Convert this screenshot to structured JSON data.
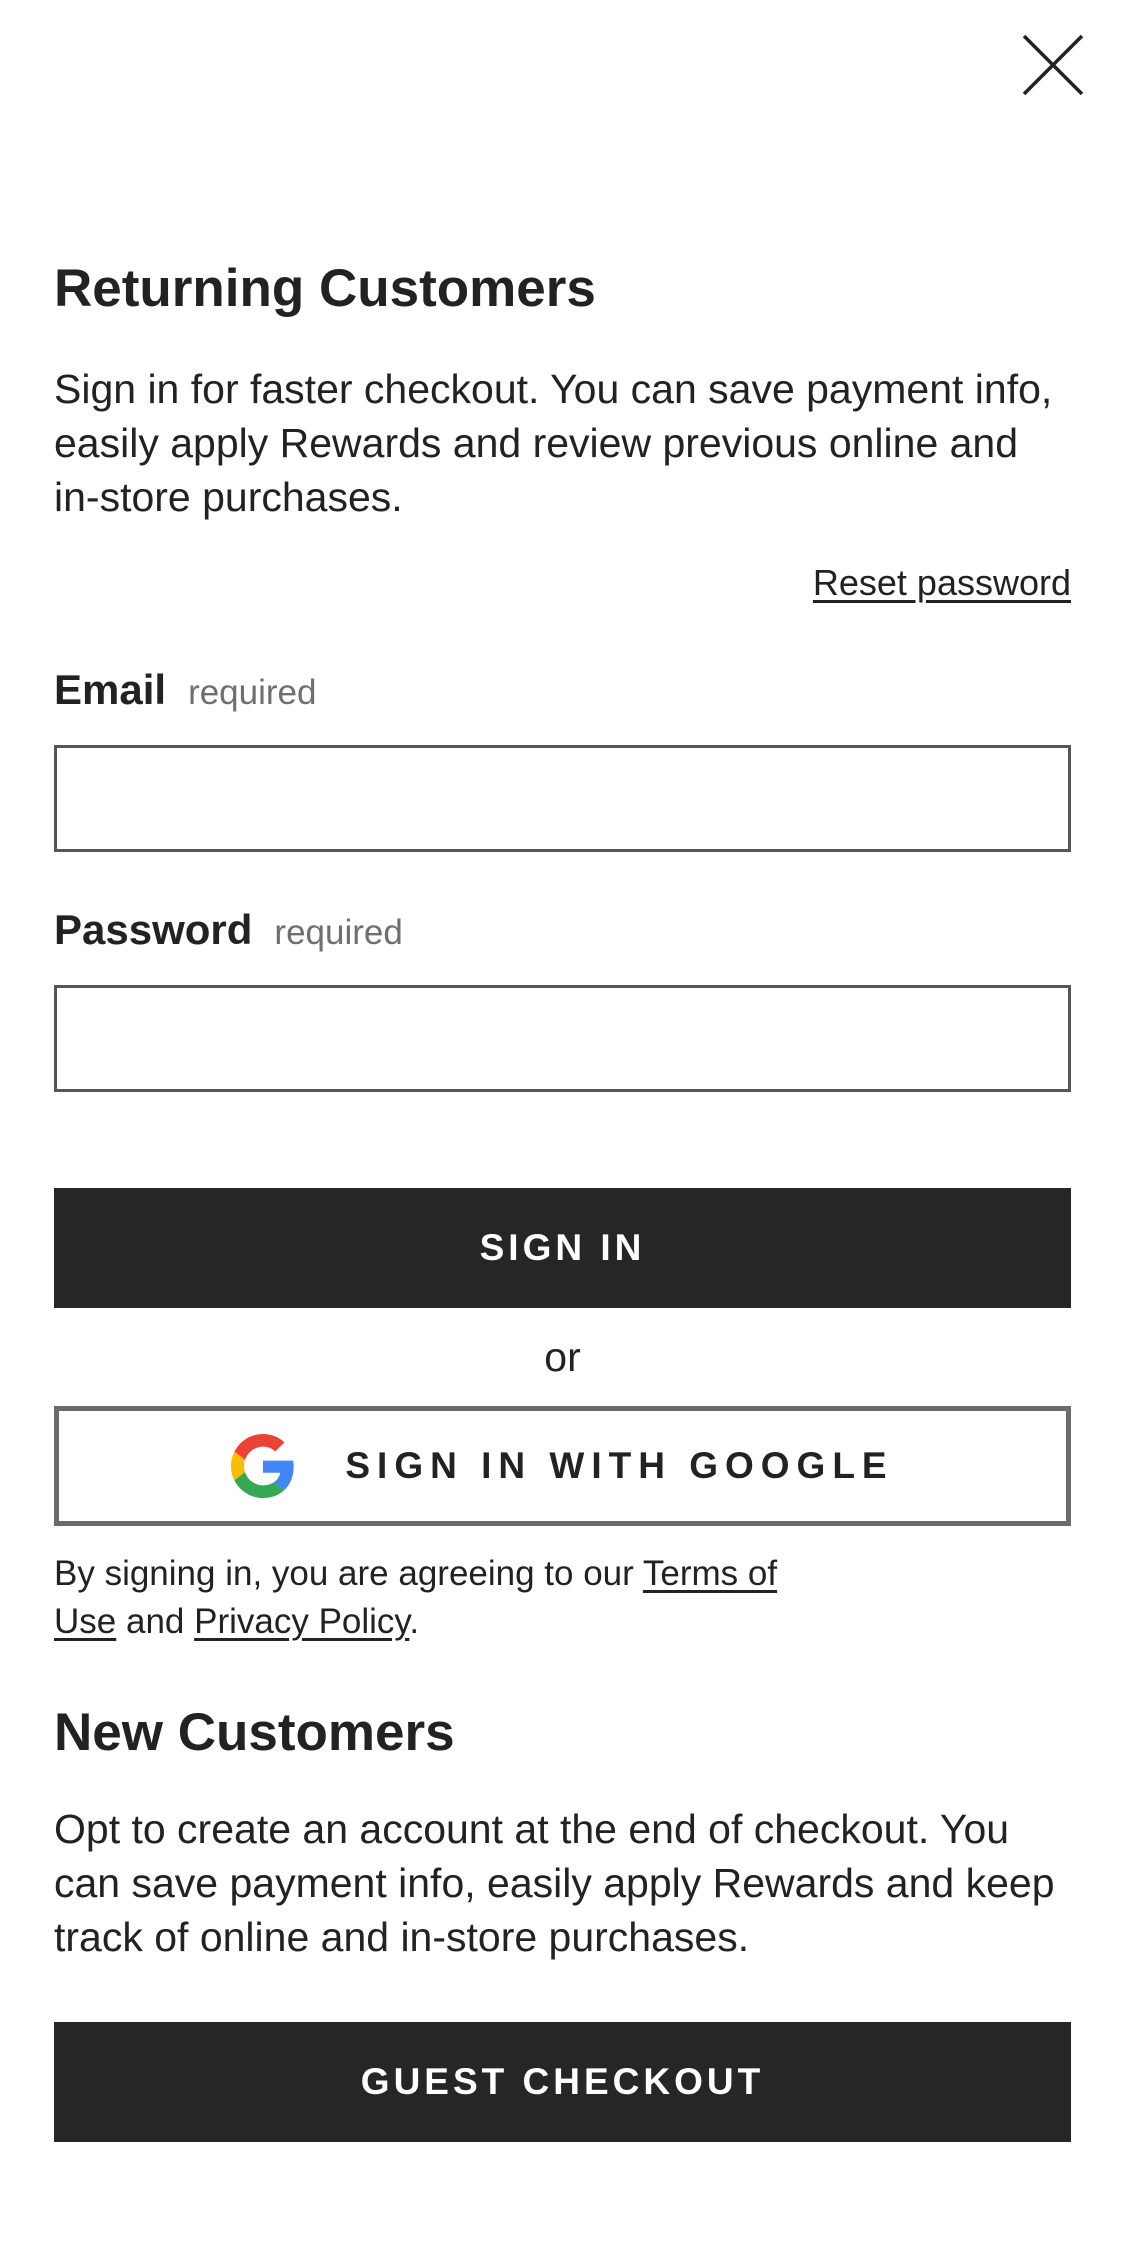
{
  "close": {
    "icon": "close-icon"
  },
  "returning": {
    "title": "Returning Customers",
    "description": "Sign in for faster checkout. You can save payment info, easily apply Rewards and review previous online and in-store purchases.",
    "reset_password": "Reset password"
  },
  "form": {
    "email": {
      "label": "Email",
      "required_text": "required",
      "value": "",
      "placeholder": ""
    },
    "password": {
      "label": "Password",
      "required_text": "required",
      "value": "",
      "placeholder": ""
    },
    "sign_in_label": "SIGN IN",
    "or_text": "or",
    "google_label": "SIGN IN WITH GOOGLE",
    "google_icon": "google-icon"
  },
  "legal": {
    "prefix": "By signing in, you are agreeing to our ",
    "terms": "Terms of Use",
    "and": " and ",
    "privacy": "Privacy Policy",
    "suffix": "."
  },
  "new_customers": {
    "title": "New Customers",
    "description": "Opt to create an account at the end of checkout. You can save payment info, easily apply Rewards and keep track of online and in-store purchases.",
    "guest_checkout_label": "GUEST CHECKOUT"
  },
  "colors": {
    "button_dark": "#262626",
    "text": "#222222",
    "muted": "#6f6f6f",
    "input_border": "#555555",
    "google_border": "#6b6b6b"
  }
}
